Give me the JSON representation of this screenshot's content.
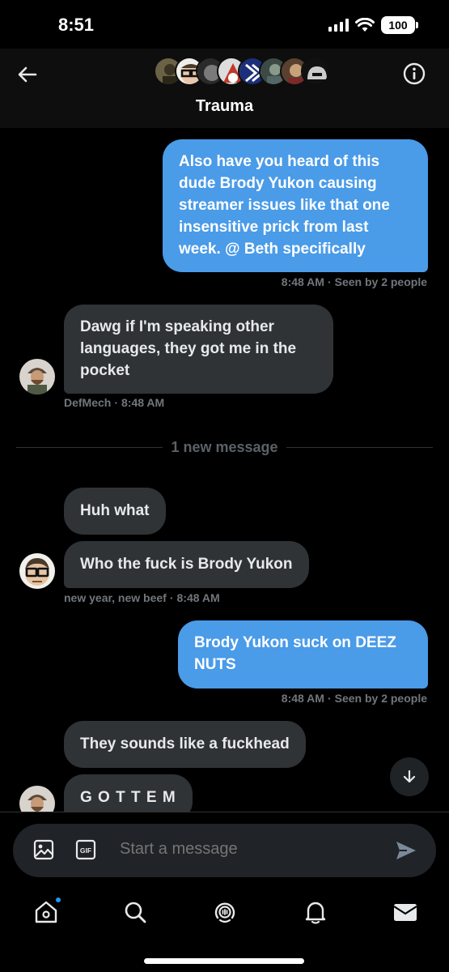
{
  "status": {
    "time": "8:51",
    "battery": "100"
  },
  "header": {
    "title": "Trauma"
  },
  "messages": [
    {
      "text": "Also have you heard of this dude Brody Yukon causing streamer issues like that one insensitive prick from last week. @ Beth specifically",
      "time": "8:48 AM",
      "seen": "Seen by 2 people"
    },
    {
      "text": "Dawg if I'm speaking other languages, they got me in the pocket",
      "sender": "DefMech",
      "time": "8:48 AM"
    },
    {
      "text": "Huh what"
    },
    {
      "text": "Who the fuck is Brody Yukon",
      "sender": "new year, new beef",
      "time": "8:48 AM"
    },
    {
      "text": "Brody Yukon suck on DEEZ NUTS",
      "time": "8:48 AM",
      "seen": "Seen by 2 people"
    },
    {
      "text": "They sounds like a fuckhead"
    },
    {
      "text": "G O T T E M"
    }
  ],
  "divider": {
    "text": "1 new message"
  },
  "composer": {
    "placeholder": "Start a message"
  },
  "icons": {
    "back": "back-arrow-icon",
    "info": "info-icon",
    "image": "image-icon",
    "gif": "gif-icon",
    "send": "send-icon",
    "scroll": "arrow-down-icon",
    "nav": [
      "home-icon",
      "search-icon",
      "spaces-icon",
      "notifications-icon",
      "messages-icon"
    ]
  },
  "colors": {
    "outgoing_bubble": "#4a9be8",
    "incoming_bubble": "#2f3336",
    "accent": "#1d9bf0",
    "background": "#000000"
  }
}
